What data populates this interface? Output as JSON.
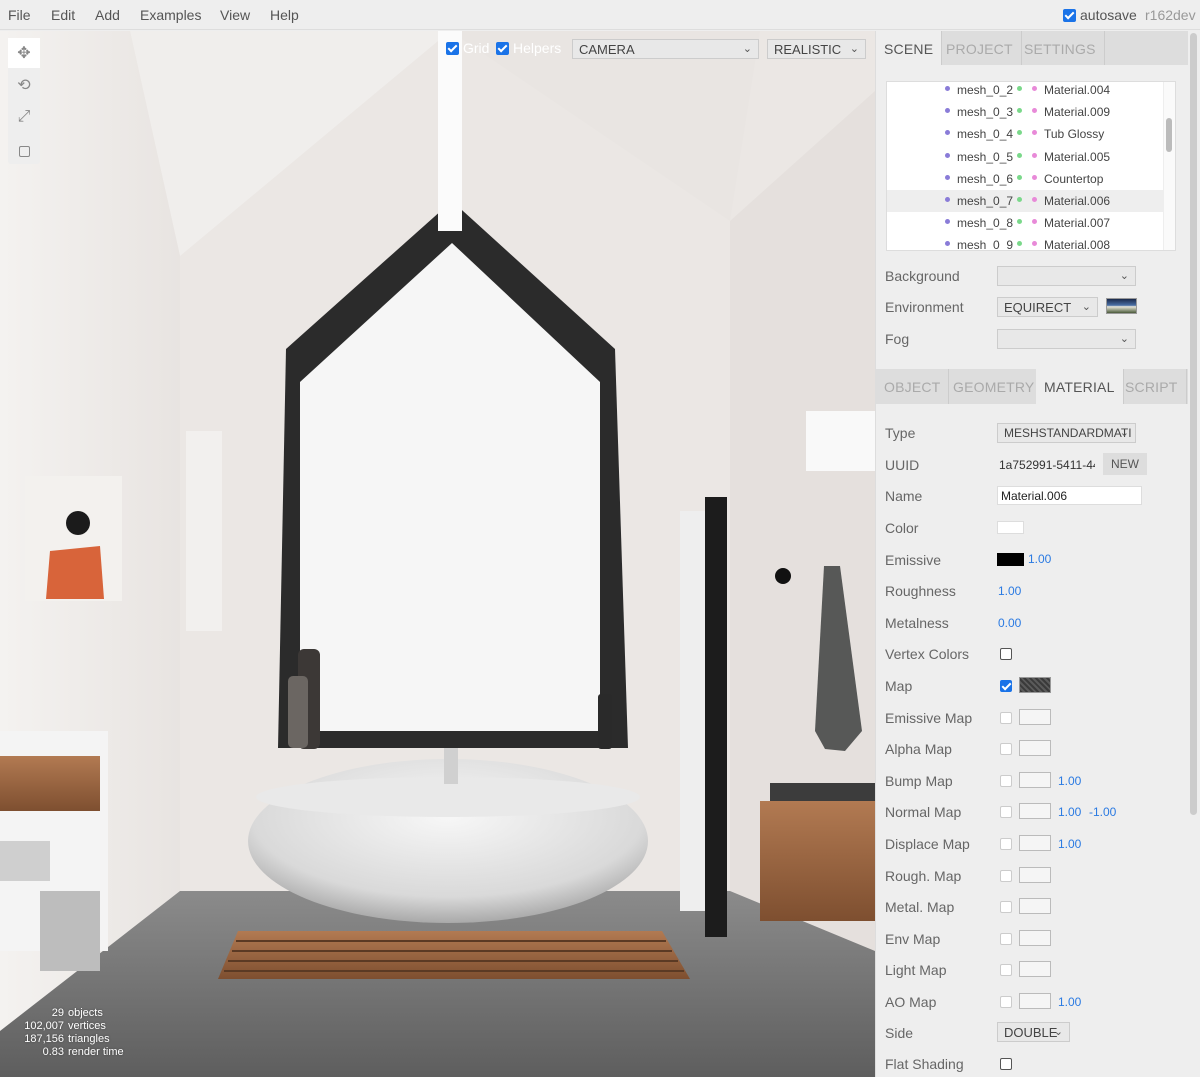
{
  "menubar": {
    "items": [
      "File",
      "Edit",
      "Add",
      "Examples",
      "View",
      "Help"
    ],
    "autosave_label": "autosave",
    "version": "r162dev"
  },
  "viewport": {
    "grid_label": "Grid",
    "helpers_label": "Helpers",
    "camera_select": "CAMERA",
    "shading_select": "REALISTIC",
    "info": [
      {
        "value": "29",
        "label": "objects"
      },
      {
        "value": "102,007",
        "label": "vertices"
      },
      {
        "value": "187,156",
        "label": "triangles"
      },
      {
        "value": "0.83",
        "label": "render time"
      }
    ],
    "tools": [
      "move-icon",
      "rotate-icon",
      "scale-icon",
      "local-icon"
    ]
  },
  "sidebar": {
    "top_tabs": [
      "SCENE",
      "PROJECT",
      "SETTINGS"
    ],
    "outliner": [
      {
        "mesh": "mesh_0_2",
        "material": "Material.004"
      },
      {
        "mesh": "mesh_0_3",
        "material": "Material.009"
      },
      {
        "mesh": "mesh_0_4",
        "material": "Tub Glossy"
      },
      {
        "mesh": "mesh_0_5",
        "material": "Material.005"
      },
      {
        "mesh": "mesh_0_6",
        "material": "Countertop"
      },
      {
        "mesh": "mesh_0_7",
        "material": "Material.006"
      },
      {
        "mesh": "mesh_0_8",
        "material": "Material.007"
      },
      {
        "mesh": "mesh_0_9",
        "material": "Material.008"
      }
    ],
    "scene_props": {
      "background_label": "Background",
      "background_value": "",
      "environment_label": "Environment",
      "environment_value": "EQUIRECT",
      "fog_label": "Fog",
      "fog_value": ""
    },
    "props_tabs": [
      "OBJECT",
      "GEOMETRY",
      "MATERIAL",
      "SCRIPT"
    ],
    "material": {
      "type_label": "Type",
      "type_value": "MESHSTANDARDMATI",
      "uuid_label": "UUID",
      "uuid_value": "1a752991-5411-44",
      "new_button": "NEW",
      "name_label": "Name",
      "name_value": "Material.006",
      "color_label": "Color",
      "color_value": "#ffffff",
      "emissive_label": "Emissive",
      "emissive_color": "#000000",
      "emissive_intensity": "1.00",
      "roughness_label": "Roughness",
      "roughness_value": "1.00",
      "metalness_label": "Metalness",
      "metalness_value": "0.00",
      "vertex_colors_label": "Vertex Colors",
      "maps": [
        {
          "label": "Map",
          "enabled": true,
          "has_texture": true,
          "values": []
        },
        {
          "label": "Emissive Map",
          "enabled": false,
          "has_texture": false,
          "values": []
        },
        {
          "label": "Alpha Map",
          "enabled": false,
          "has_texture": false,
          "values": []
        },
        {
          "label": "Bump Map",
          "enabled": false,
          "has_texture": false,
          "values": [
            "1.00"
          ]
        },
        {
          "label": "Normal Map",
          "enabled": false,
          "has_texture": false,
          "values": [
            "1.00",
            "-1.00"
          ]
        },
        {
          "label": "Displace Map",
          "enabled": false,
          "has_texture": false,
          "values": [
            "1.00"
          ]
        },
        {
          "label": "Rough. Map",
          "enabled": false,
          "has_texture": false,
          "values": []
        },
        {
          "label": "Metal. Map",
          "enabled": false,
          "has_texture": false,
          "values": []
        },
        {
          "label": "Env Map",
          "enabled": false,
          "has_texture": false,
          "values": []
        },
        {
          "label": "Light Map",
          "enabled": false,
          "has_texture": false,
          "values": []
        },
        {
          "label": "AO Map",
          "enabled": false,
          "has_texture": false,
          "values": [
            "1.00"
          ]
        }
      ],
      "side_label": "Side",
      "side_value": "DOUBLE",
      "flat_shading_label": "Flat Shading"
    }
  }
}
